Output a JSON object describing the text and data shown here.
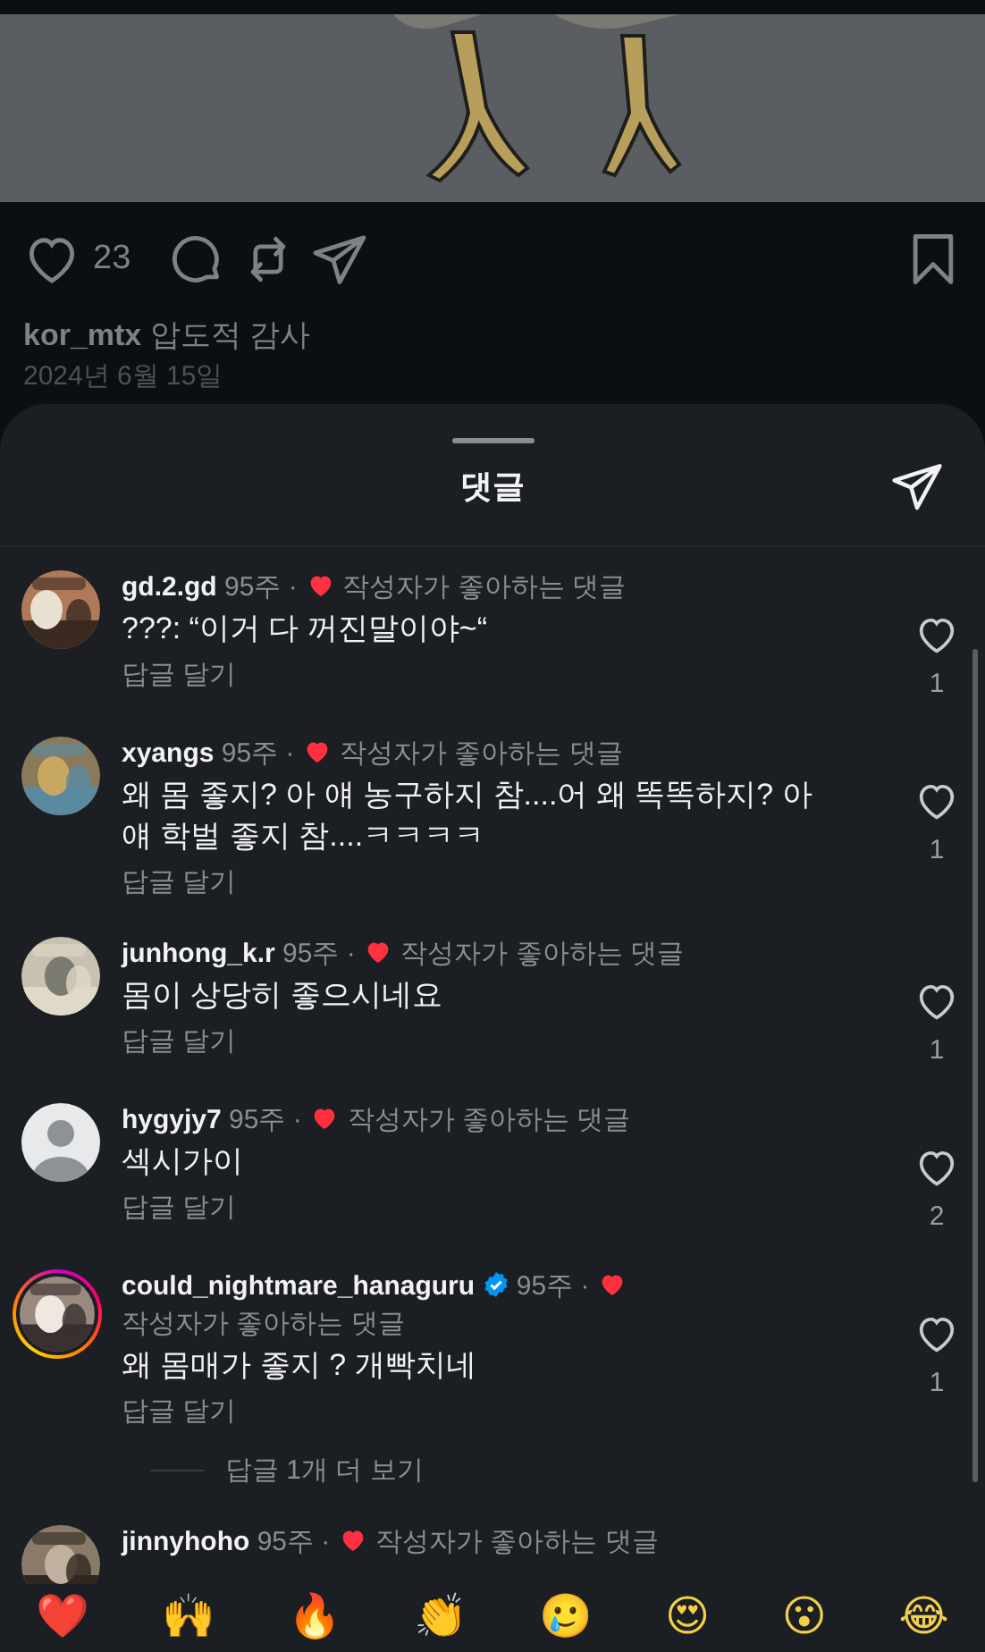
{
  "post": {
    "like_count": "23",
    "caption": {
      "username": "kor_mtx",
      "text": "압도적 감사"
    },
    "date": "2024년 6월 15일"
  },
  "sheet": {
    "title": "댓글"
  },
  "comments": [
    {
      "username": "gd.2.gd",
      "verified": false,
      "story_ring": false,
      "time": "95주 ·",
      "liked_by_author": true,
      "author_label": "작성자가 좋아하는 댓글",
      "text": "???: “이거 다 꺼진말이야~“",
      "reply": "답글 달기",
      "like_count": "1"
    },
    {
      "username": "xyangs",
      "verified": false,
      "story_ring": false,
      "time": "95주 ·",
      "liked_by_author": true,
      "author_label": "작성자가 좋아하는 댓글",
      "text": "왜 몸 좋지? 아 얘 농구하지 참....어 왜 똑똑하지? 아 얘 학벌 좋지 참....ㅋㅋㅋㅋ",
      "reply": "답글 달기",
      "like_count": "1"
    },
    {
      "username": "junhong_k.r",
      "verified": false,
      "story_ring": false,
      "time": "95주 ·",
      "liked_by_author": true,
      "author_label": "작성자가 좋아하는 댓글",
      "text": "몸이 상당히 좋으시네요",
      "reply": "답글 달기",
      "like_count": "1"
    },
    {
      "username": "hygyjy7",
      "verified": false,
      "story_ring": false,
      "avatar": {
        "kind": "default"
      },
      "time": "95주 ·",
      "liked_by_author": true,
      "author_label": "작성자가 좋아하는 댓글",
      "text": "섹시가이",
      "reply": "답글 달기",
      "like_count": "2"
    },
    {
      "username": "could_nightmare_hanaguru",
      "verified": true,
      "story_ring": true,
      "time": "95주 ·",
      "liked_by_author": true,
      "author_label": "작성자가 좋아하는 댓글",
      "text": "왜 몸매가 좋지 ? 개빡치네",
      "reply": "답글 달기",
      "like_count": "1",
      "more_replies": "답글 1개 더 보기"
    },
    {
      "username": "jinnyhoho",
      "verified": false,
      "story_ring": false,
      "time": "95주 ·",
      "liked_by_author": true,
      "author_label": "작성자가 좋아하는 댓글"
    }
  ],
  "emojis": [
    "❤️",
    "🙌",
    "🔥",
    "👏",
    "🥲",
    "😍",
    "😮",
    "😂"
  ]
}
